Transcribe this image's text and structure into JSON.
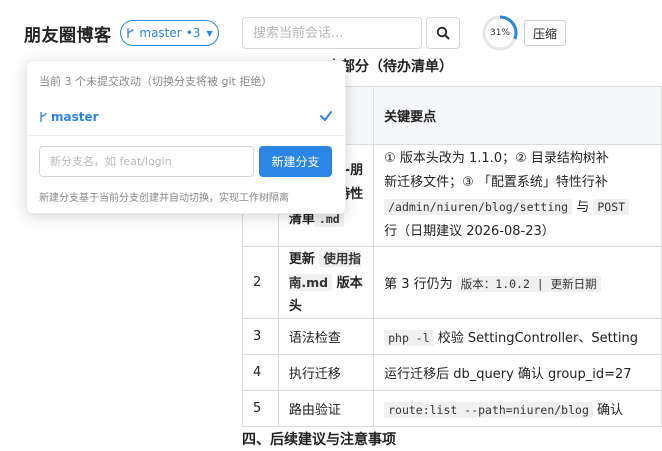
{
  "header": {
    "app_title": "朋友圈博客",
    "branch": {
      "name": "master",
      "dirty": "•3"
    },
    "search": {
      "placeholder": "搜索当前会话..."
    },
    "progress": {
      "percent": 31,
      "label": "31%"
    },
    "compress_label": "压缩"
  },
  "doc": {
    "section_heading_partial": "内部分（待办清单）",
    "table": {
      "headers": [
        "",
        "",
        "关键要点"
      ],
      "rows": [
        {
          "num": "",
          "task_bold_pre": "Pro-朋",
          "task_bold_mid": "写-特性",
          "task_bold_end": "清单",
          "task_code": ".md",
          "key_line1": "① 版本头改为 1.1.0；② 目录结构树补",
          "key_line2": "新迁移文件；③ 「配置系统」特性行补",
          "key_code_a": "/admin/niuren/blog/setting",
          "key_mid": " 与 ",
          "key_code_b": "POST",
          "key_line4": "行（日期建议 2026-08-23）"
        },
        {
          "num": "2",
          "task_pre": "更新",
          "task_code": "使用指南.md",
          "task_post": "版本头",
          "key_pre": "第 3 行仍为 ",
          "key_code": "版本：1.0.2 | 更新日期"
        },
        {
          "num": "3",
          "task": "语法检查",
          "key_code": "php -l",
          "key_post": " 校验 SettingController、Setting"
        },
        {
          "num": "4",
          "task": "执行迁移",
          "key": "运行迁移后 db_query 确认 group_id=27"
        },
        {
          "num": "5",
          "task": "路由验证",
          "key_code": "route:list --path=niuren/blog",
          "key_post": " 确认"
        }
      ]
    },
    "next_heading": "四、后续建议与注意事项"
  },
  "dropdown": {
    "note": "当前 3 个未提交改动（切换分支将被 git 拒绝）",
    "current_branch": "master",
    "new_branch_placeholder": "新分支名，如 feat/login",
    "new_branch_button": "新建分支",
    "hint": "新建分支基于当前分支创建并自动切换，实现工作树隔离"
  },
  "colors": {
    "accent": "#2b85e4",
    "ring_track": "#e5e5e5"
  },
  "icons": {
    "branch": "git-branch-icon",
    "search": "search-icon",
    "check": "check-icon",
    "caret": "caret-down-icon"
  }
}
